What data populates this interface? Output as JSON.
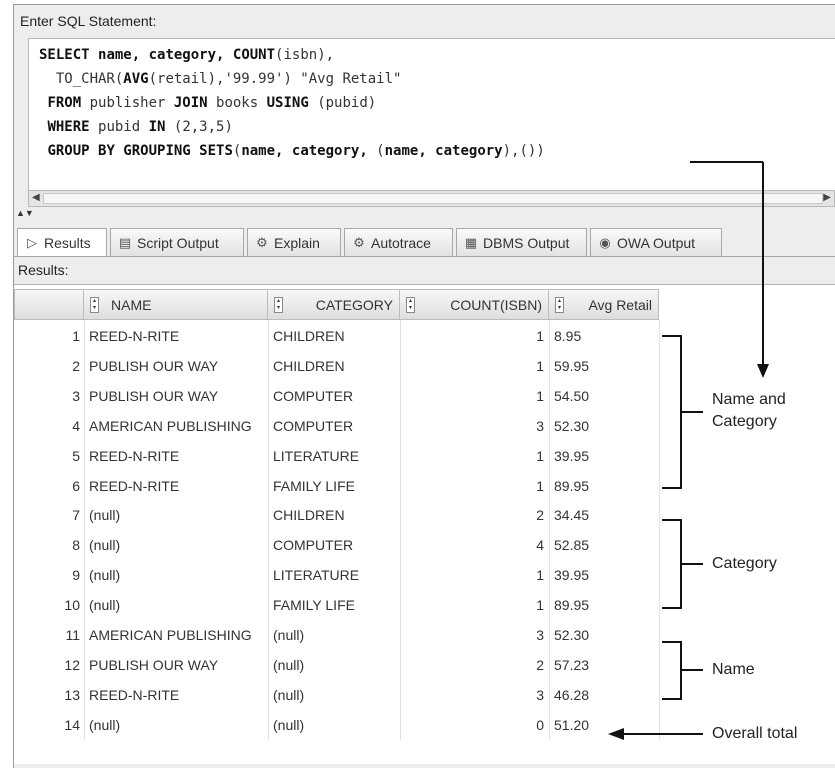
{
  "editor": {
    "label": "Enter SQL Statement:",
    "lines": [
      [
        {
          "t": "SELECT",
          "k": true
        },
        {
          "t": " "
        },
        {
          "t": "name, category,",
          "k": true
        },
        {
          "t": " "
        },
        {
          "t": "COUNT",
          "k": true
        },
        {
          "t": "(isbn),"
        }
      ],
      [
        {
          "t": "  TO_CHAR("
        },
        {
          "t": "AVG",
          "k": true
        },
        {
          "t": "(retail),'99.99') \"Avg Retail\""
        }
      ],
      [
        {
          "t": " "
        },
        {
          "t": "FROM",
          "k": true
        },
        {
          "t": " publisher "
        },
        {
          "t": "JOIN",
          "k": true
        },
        {
          "t": " books "
        },
        {
          "t": "USING",
          "k": true
        },
        {
          "t": " (pubid)"
        }
      ],
      [
        {
          "t": " "
        },
        {
          "t": "WHERE",
          "k": true
        },
        {
          "t": " pubid "
        },
        {
          "t": "IN",
          "k": true
        },
        {
          "t": " (2,3,5)"
        }
      ],
      [
        {
          "t": " "
        },
        {
          "t": "GROUP BY GROUPING SETS",
          "k": true
        },
        {
          "t": "("
        },
        {
          "t": "name, category,",
          "k": true
        },
        {
          "t": " ("
        },
        {
          "t": "name, category",
          "k": true
        },
        {
          "t": "),())"
        }
      ]
    ]
  },
  "tabs": [
    {
      "label": "Results",
      "icon": "play-icon",
      "glyph": "▷",
      "active": true
    },
    {
      "label": "Script Output",
      "icon": "script-output-icon",
      "glyph": "▤",
      "active": false
    },
    {
      "label": "Explain",
      "icon": "explain-icon",
      "glyph": "⚙",
      "active": false
    },
    {
      "label": "Autotrace",
      "icon": "autotrace-icon",
      "glyph": "⚙",
      "active": false
    },
    {
      "label": "DBMS Output",
      "icon": "dbms-output-icon",
      "glyph": "▦",
      "active": false
    },
    {
      "label": "OWA Output",
      "icon": "owa-output-icon",
      "glyph": "◉",
      "active": false
    }
  ],
  "results": {
    "label": "Results:",
    "columns": [
      "NAME",
      "CATEGORY",
      "COUNT(ISBN)",
      "Avg Retail"
    ],
    "rows": [
      [
        "1",
        "REED-N-RITE",
        "CHILDREN",
        "1",
        "8.95"
      ],
      [
        "2",
        "PUBLISH OUR WAY",
        "CHILDREN",
        "1",
        "59.95"
      ],
      [
        "3",
        "PUBLISH OUR WAY",
        "COMPUTER",
        "1",
        "54.50"
      ],
      [
        "4",
        "AMERICAN PUBLISHING",
        "COMPUTER",
        "3",
        "52.30"
      ],
      [
        "5",
        "REED-N-RITE",
        "LITERATURE",
        "1",
        "39.95"
      ],
      [
        "6",
        "REED-N-RITE",
        "FAMILY LIFE",
        "1",
        "89.95"
      ],
      [
        "7",
        "(null)",
        "CHILDREN",
        "2",
        "34.45"
      ],
      [
        "8",
        "(null)",
        "COMPUTER",
        "4",
        "52.85"
      ],
      [
        "9",
        "(null)",
        "LITERATURE",
        "1",
        "39.95"
      ],
      [
        "10",
        "(null)",
        "FAMILY LIFE",
        "1",
        "89.95"
      ],
      [
        "11",
        "AMERICAN PUBLISHING",
        "(null)",
        "3",
        "52.30"
      ],
      [
        "12",
        "PUBLISH OUR WAY",
        "(null)",
        "2",
        "57.23"
      ],
      [
        "13",
        "REED-N-RITE",
        "(null)",
        "3",
        "46.28"
      ],
      [
        "14",
        "(null)",
        "(null)",
        "0",
        "51.20"
      ]
    ]
  },
  "annotations": {
    "name_and_category": [
      "Name and",
      "Category"
    ],
    "category": "Category",
    "name": "Name",
    "overall_total": "Overall total"
  },
  "colors": {
    "panel_bg": "#ededed",
    "grid_line": "#e2e2e2",
    "annotation": "#111111"
  }
}
